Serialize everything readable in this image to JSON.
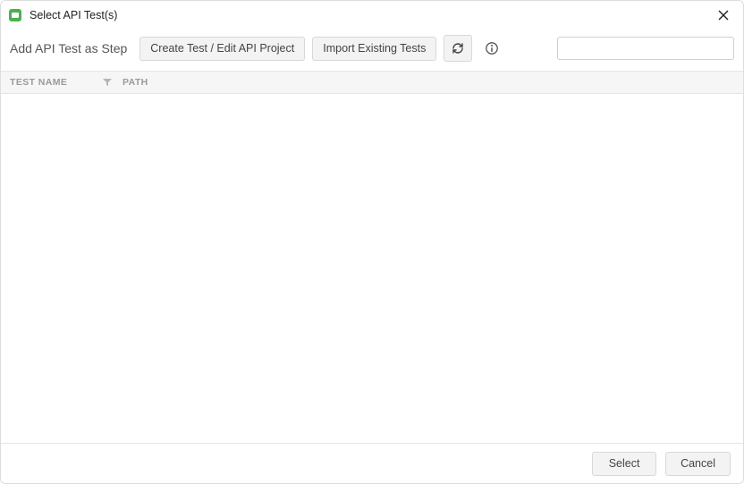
{
  "window": {
    "title": "Select API Test(s)"
  },
  "toolbar": {
    "label": "Add API Test as Step",
    "create_btn": "Create Test / Edit API Project",
    "import_btn": "Import Existing Tests",
    "search_value": ""
  },
  "table": {
    "columns": {
      "name": "TEST NAME",
      "path": "PATH"
    },
    "rows": []
  },
  "footer": {
    "select": "Select",
    "cancel": "Cancel"
  }
}
